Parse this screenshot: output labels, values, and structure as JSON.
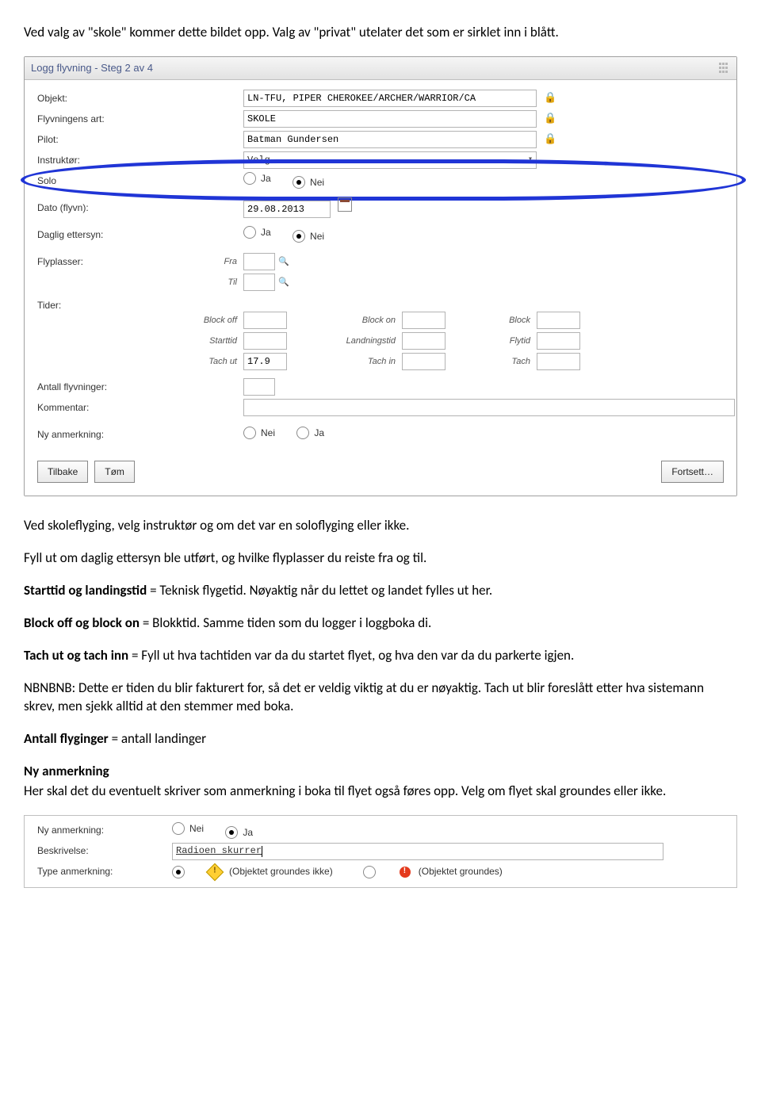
{
  "intro": "Ved valg av \"skole\" kommer dette bildet opp. Valg av \"privat\" utelater det som er sirklet inn i blått.",
  "shot1": {
    "title": "Logg flyvning - Steg 2 av 4",
    "fields": {
      "objekt_lbl": "Objekt:",
      "objekt_val": "LN-TFU, PIPER CHEROKEE/ARCHER/WARRIOR/CA",
      "art_lbl": "Flyvningens art:",
      "art_val": "SKOLE",
      "pilot_lbl": "Pilot:",
      "pilot_val": "Batman Gundersen",
      "instr_lbl": "Instruktør:",
      "instr_val": "Velg...",
      "solo_lbl": "Solo",
      "solo_ja": "Ja",
      "solo_nei": "Nei",
      "dato_lbl": "Dato (flyvn):",
      "dato_val": "29.08.2013",
      "daglig_lbl": "Daglig ettersyn:",
      "daglig_ja": "Ja",
      "daglig_nei": "Nei",
      "flyplasser_lbl": "Flyplasser:",
      "fra_lbl": "Fra",
      "til_lbl": "Til",
      "tider_lbl": "Tider:",
      "blockoff": "Block off",
      "blockon": "Block on",
      "block": "Block",
      "starttid": "Starttid",
      "landingstid": "Landningstid",
      "flytid": "Flytid",
      "tachut": "Tach ut",
      "tachut_val": "17.9",
      "tachin": "Tach in",
      "tach": "Tach",
      "antall_lbl": "Antall flyvninger:",
      "kommentar_lbl": "Kommentar:",
      "nyanm_lbl": "Ny anmerkning:",
      "nyanm_nei": "Nei",
      "nyanm_ja": "Ja",
      "btn_tilbake": "Tilbake",
      "btn_tom": "Tøm",
      "btn_fortsett": "Fortsett…"
    }
  },
  "body": {
    "p1": "Ved skoleflyging, velg instruktør og om det var en soloflyging eller ikke.",
    "p2": "Fyll ut om daglig ettersyn ble utført, og hvilke flyplasser du reiste fra og til.",
    "p3a": "Starttid og landingstid",
    "p3b": " = Teknisk flygetid. Nøyaktig når du lettet og landet fylles ut her.",
    "p4a": "Block off og block on",
    "p4b": " = Blokktid. Samme tiden som du logger i loggboka di.",
    "p5a": "Tach ut og tach inn",
    "p5b": " = Fyll ut hva tachtiden var da du startet flyet, og hva den var da du parkerte igjen.",
    "p6": "NBNBNB: Dette er tiden du blir fakturert for, så det er veldig viktig at du er nøyaktig. Tach ut blir foreslått etter hva sistemann skrev, men sjekk alltid at den stemmer med boka.",
    "p7a": "Antall flyginger",
    "p7b": " = antall landinger",
    "h_ny": "Ny anmerkning",
    "p8": "Her skal det du eventuelt skriver som anmerkning i boka til flyet også føres opp. Velg om flyet skal groundes eller ikke."
  },
  "shot2": {
    "nyanm_lbl": "Ny anmerkning:",
    "nei": "Nei",
    "ja": "Ja",
    "beskr_lbl": "Beskrivelse:",
    "beskr_val": "Radioen skurrer",
    "type_lbl": "Type anmerkning:",
    "opt_not": "(Objektet groundes ikke)",
    "opt_yes": "(Objektet groundes)"
  }
}
